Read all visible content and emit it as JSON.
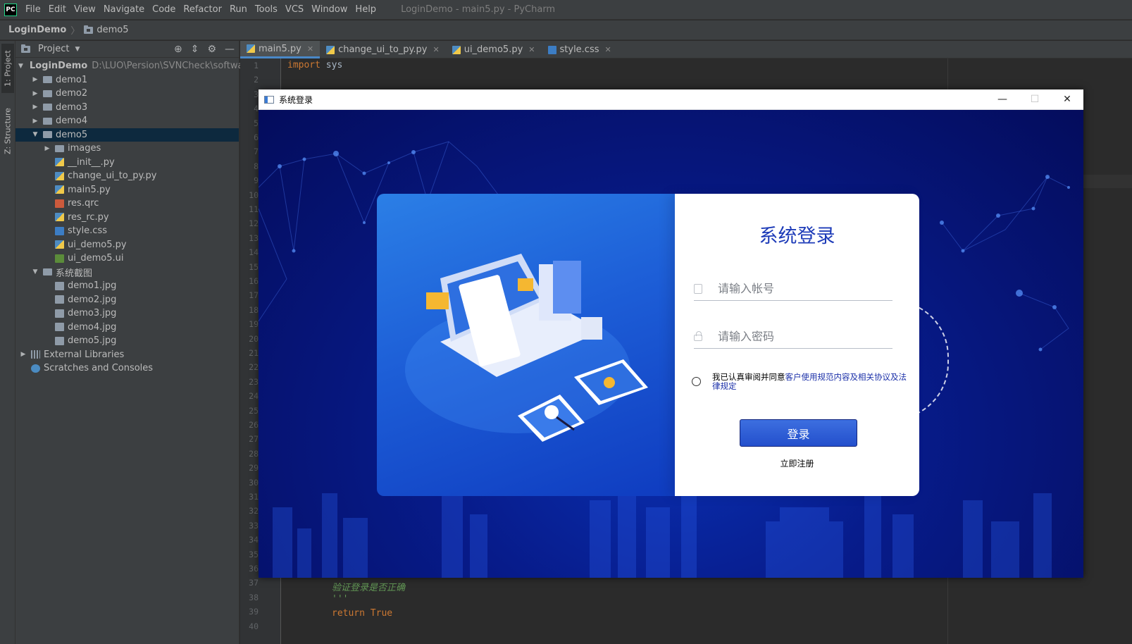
{
  "ide": {
    "menu": [
      "File",
      "Edit",
      "View",
      "Navigate",
      "Code",
      "Refactor",
      "Run",
      "Tools",
      "VCS",
      "Window",
      "Help"
    ],
    "window_title": "LoginDemo - main5.py - PyCharm",
    "logo_text": "PC",
    "breadcrumb": {
      "project": "LoginDemo",
      "folder": "demo5"
    },
    "stripe": {
      "project_tab": "1: Project",
      "structure_tab": "Z: Structure"
    },
    "project_panel": {
      "title": "Project",
      "tree": [
        {
          "label": "LoginDemo",
          "path": "D:\\LUO\\Persion\\SVNCheck\\software",
          "depth": 0,
          "arrow": "down",
          "icon": "folder",
          "bold": true
        },
        {
          "label": "demo1",
          "depth": 1,
          "arrow": "right",
          "icon": "folder"
        },
        {
          "label": "demo2",
          "depth": 1,
          "arrow": "right",
          "icon": "folder"
        },
        {
          "label": "demo3",
          "depth": 1,
          "arrow": "right",
          "icon": "folder"
        },
        {
          "label": "demo4",
          "depth": 1,
          "arrow": "right",
          "icon": "folder"
        },
        {
          "label": "demo5",
          "depth": 1,
          "arrow": "down",
          "icon": "folder",
          "selected": true
        },
        {
          "label": "images",
          "depth": 2,
          "arrow": "right",
          "icon": "folder"
        },
        {
          "label": "__init__.py",
          "depth": 2,
          "icon": "py"
        },
        {
          "label": "change_ui_to_py.py",
          "depth": 2,
          "icon": "py"
        },
        {
          "label": "main5.py",
          "depth": 2,
          "icon": "py"
        },
        {
          "label": "res.qrc",
          "depth": 2,
          "icon": "qrc"
        },
        {
          "label": "res_rc.py",
          "depth": 2,
          "icon": "py"
        },
        {
          "label": "style.css",
          "depth": 2,
          "icon": "css"
        },
        {
          "label": "ui_demo5.py",
          "depth": 2,
          "icon": "py"
        },
        {
          "label": "ui_demo5.ui",
          "depth": 2,
          "icon": "ui"
        },
        {
          "label": "系统截图",
          "depth": 1,
          "arrow": "down",
          "icon": "folder"
        },
        {
          "label": "demo1.jpg",
          "depth": 2,
          "icon": "jpg"
        },
        {
          "label": "demo2.jpg",
          "depth": 2,
          "icon": "jpg"
        },
        {
          "label": "demo3.jpg",
          "depth": 2,
          "icon": "jpg"
        },
        {
          "label": "demo4.jpg",
          "depth": 2,
          "icon": "jpg"
        },
        {
          "label": "demo5.jpg",
          "depth": 2,
          "icon": "jpg"
        },
        {
          "label": "External Libraries",
          "depth": 0,
          "arrow": "right",
          "icon": "lib"
        },
        {
          "label": "Scratches and Consoles",
          "depth": 0,
          "icon": "scratch"
        }
      ]
    },
    "tabs": [
      {
        "label": "main5.py",
        "icon": "py",
        "active": true
      },
      {
        "label": "change_ui_to_py.py",
        "icon": "py"
      },
      {
        "label": "ui_demo5.py",
        "icon": "py"
      },
      {
        "label": "style.css",
        "icon": "css"
      }
    ],
    "editor": {
      "line_numbers_top": [
        "1",
        "2",
        "3",
        "4",
        "5",
        "6",
        "7",
        "8",
        "9",
        "10",
        "11",
        "12",
        "13",
        "14",
        "15",
        "16",
        "17",
        "18",
        "19",
        "20",
        "21",
        "22",
        "23",
        "24",
        "25",
        "26",
        "27",
        "28",
        "29",
        "30",
        "31",
        "32",
        "33",
        "34",
        "35",
        "36",
        "37",
        "38",
        "39",
        "40"
      ],
      "line1_kw": "import",
      "line1_rest": " sys",
      "line37": "验证登录是否正确",
      "line38": "'''",
      "line39_kw": "return",
      "line39_rest": " True"
    }
  },
  "dialog": {
    "title": "系统登录",
    "controls": {
      "minimize": "—",
      "maximize": "☐",
      "close": "✕"
    },
    "login": {
      "heading": "系统登录",
      "account_placeholder": "请输入帐号",
      "password_placeholder": "请输入密码",
      "agree_prefix": "我已认真审阅并同意",
      "agree_link": "客户使用规范内容及相关协议及法律规定",
      "login_button": "登录",
      "register_link": "立即注册"
    }
  },
  "colors": {
    "ide_bg": "#2b2b2b",
    "panel_bg": "#3c3f41",
    "selection": "#0d293e",
    "keyword": "#cc7832",
    "dialog_bg": "#071b8a",
    "accent_blue": "#234fcc"
  }
}
